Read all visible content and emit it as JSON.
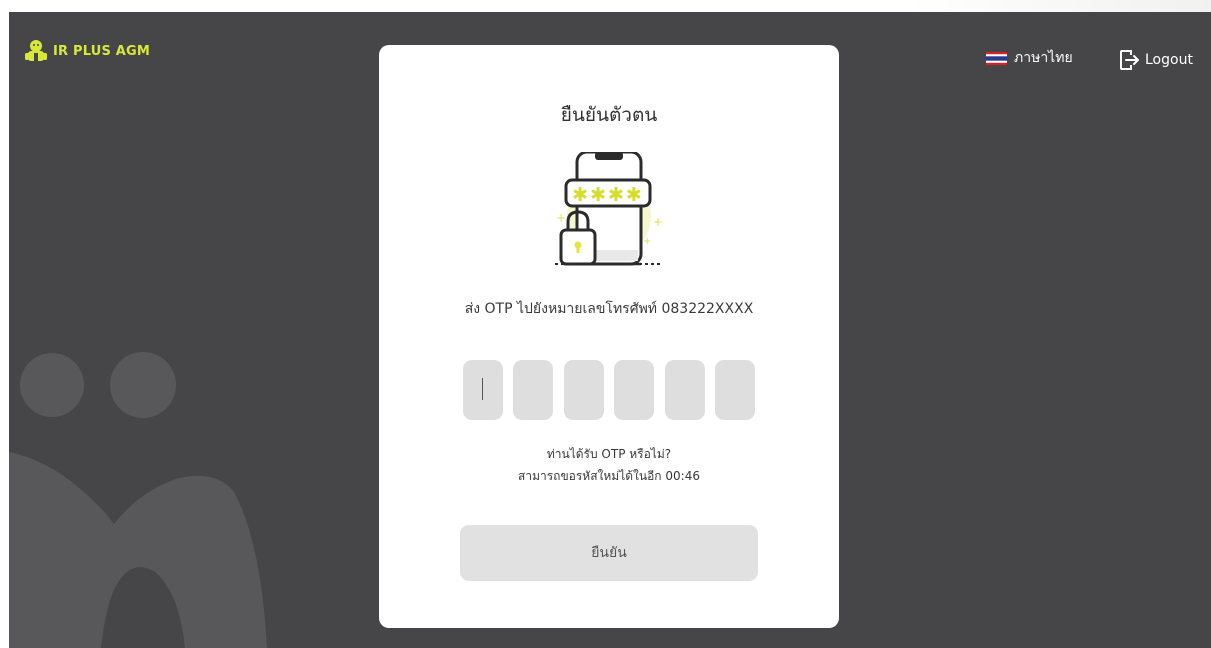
{
  "header": {
    "brand": "IR PLUS AGM",
    "brand_logo_icon": "mascot-logo-icon",
    "language": {
      "label": "ภาษาไทย",
      "icon": "thai-flag-icon"
    },
    "logout": {
      "label": "Logout",
      "icon": "logout-icon"
    }
  },
  "card": {
    "title": "ยืนยันตัวตน",
    "illustration": "phone-otp-lock-icon",
    "otp_message": "ส่ง OTP ไปยังหมายเลขโทรศัพท์ 083222XXXX",
    "otp_digits": [
      "",
      "",
      "",
      "",
      "",
      ""
    ],
    "resend_question": "ท่านได้รับ OTP หรือไม่?",
    "resend_timer": "สามารถขอรหัสใหม่ได้ในอีก 00:46",
    "confirm_label": "ยืนยัน"
  },
  "colors": {
    "background": "#464648",
    "accent": "#d8e83a",
    "card": "#ffffff",
    "otp_box": "#dedede",
    "button": "#e1e1e1"
  }
}
